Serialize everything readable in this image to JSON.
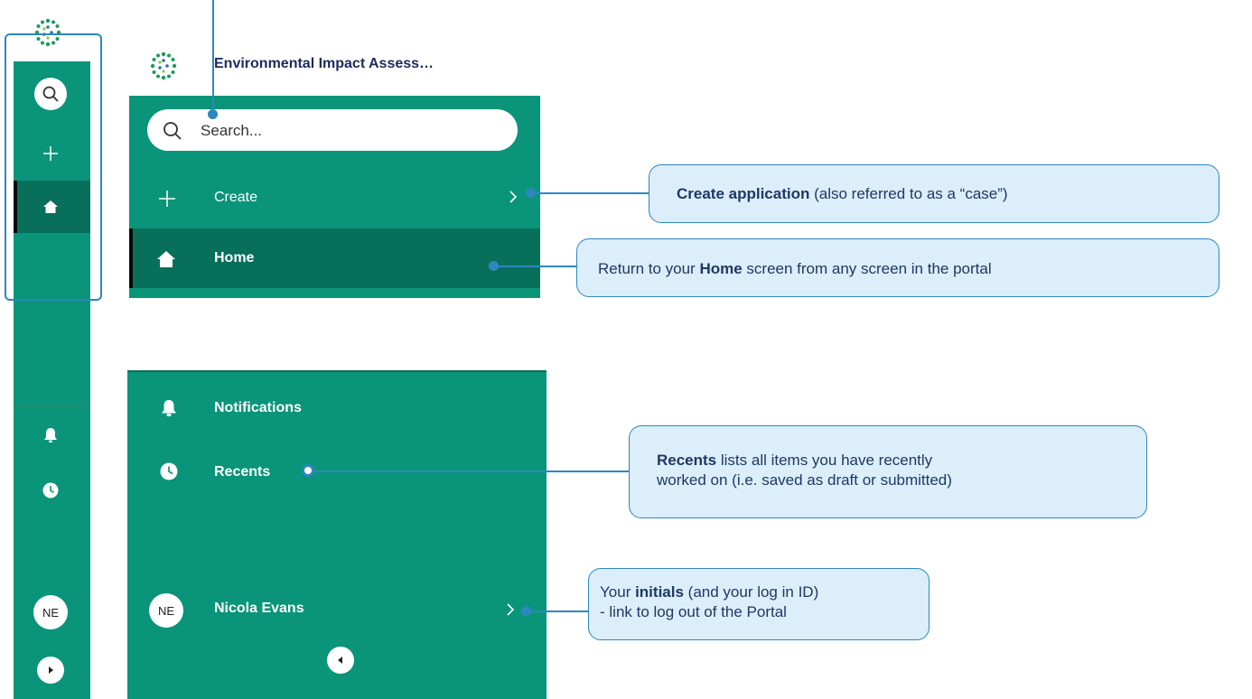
{
  "rail": {
    "logo_icon": "leaf-dots-logo",
    "search_icon": "search-icon",
    "create_icon": "plus-icon",
    "home_icon": "home-icon",
    "notifications_icon": "bell-icon",
    "recents_icon": "clock-icon",
    "avatar_initials": "NE",
    "expand_icon": "expand-arrow-icon"
  },
  "panel": {
    "title": "Environmental Impact Assess…",
    "search_placeholder": "Search...",
    "create_label": "Create",
    "home_label": "Home",
    "notifications_label": "Notifications",
    "recents_label": "Recents",
    "user_initials": "NE",
    "user_name": "Nicola Evans"
  },
  "callouts": {
    "create": {
      "bold": "Create application",
      "rest": " (also referred to as a “case”)"
    },
    "home": {
      "pre": "Return to your ",
      "bold": "Home",
      "post": " screen from any screen in the portal"
    },
    "recents": {
      "bold": "Recents",
      "rest": " lists all items you have recently",
      "line2": "worked on (i.e. saved as draft or submitted)"
    },
    "user": {
      "pre": "Your ",
      "bold": "initials",
      "post": " (and your log in ID)",
      "line2": "- link to log out of the Portal"
    }
  },
  "colors": {
    "accent": "#0a9479",
    "accent_dark": "#076f5a",
    "callout_border": "#2e86c1",
    "callout_fill": "#dbeef9"
  }
}
